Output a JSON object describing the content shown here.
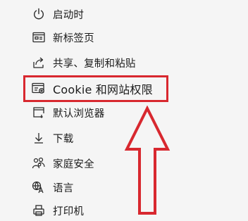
{
  "menu": {
    "items": [
      {
        "id": "startup",
        "label": "启动时",
        "icon": "power-icon"
      },
      {
        "id": "new-tab",
        "label": "新标签页",
        "icon": "new-tab-icon"
      },
      {
        "id": "share",
        "label": "共享、复制和粘贴",
        "icon": "share-icon"
      },
      {
        "id": "cookies",
        "label": "Cookie 和网站权限",
        "icon": "site-permissions-icon"
      },
      {
        "id": "default-browser",
        "label": "默认浏览器",
        "icon": "browser-icon"
      },
      {
        "id": "downloads",
        "label": "下载",
        "icon": "download-icon"
      },
      {
        "id": "family",
        "label": "家庭安全",
        "icon": "family-icon"
      },
      {
        "id": "languages",
        "label": "语言",
        "icon": "language-icon"
      },
      {
        "id": "printers",
        "label": "打印机",
        "icon": "printer-icon"
      }
    ]
  },
  "annotation": {
    "highlight_color": "#d8282f",
    "highlighted_item": "cookies"
  }
}
